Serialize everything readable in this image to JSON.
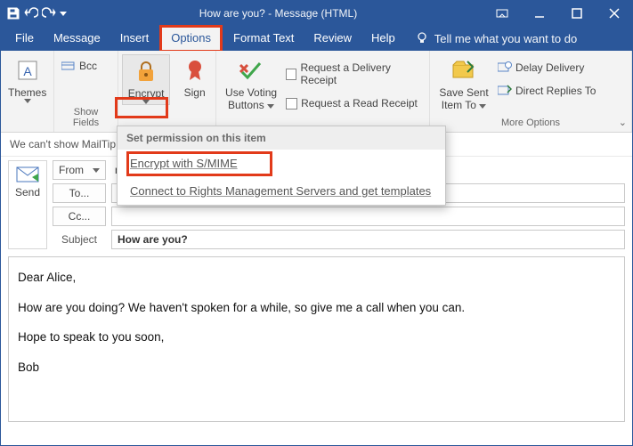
{
  "title": "How are you?  -  Message (HTML)",
  "tabs": {
    "file": "File",
    "message": "Message",
    "insert": "Insert",
    "options": "Options",
    "format": "Format Text",
    "review": "Review",
    "help": "Help",
    "tellme": "Tell me what you want to do"
  },
  "ribbon": {
    "themes": "Themes",
    "bcc": "Bcc",
    "showfields": "Show Fields",
    "encrypt": "Encrypt",
    "sign": "Sign",
    "usevoting": "Use Voting",
    "buttons": "Buttons",
    "delivery": "Request a Delivery Receipt",
    "read": "Request a Read Receipt",
    "savesent": "Save Sent",
    "itemto": "Item To",
    "delay": "Delay Delivery",
    "direct": "Direct Replies To",
    "moreoptions": "More Options"
  },
  "dropdown": {
    "hdr": "Set permission on this item",
    "smime": "Encrypt with S/MIME",
    "rms": "Connect to Rights Management Servers and get templates"
  },
  "mailtips": "We can't show MailTip",
  "compose": {
    "send": "Send",
    "from": "From",
    "fromval": "m",
    "to": "To...",
    "cc": "Cc...",
    "subject": "Subject",
    "subjectval": "How are you?"
  },
  "body": {
    "p1": "Dear Alice,",
    "p2": "How are you doing? We haven't spoken for a while, so give me a call when you can.",
    "p3": "Hope to speak to you soon,",
    "p4": "Bob"
  }
}
